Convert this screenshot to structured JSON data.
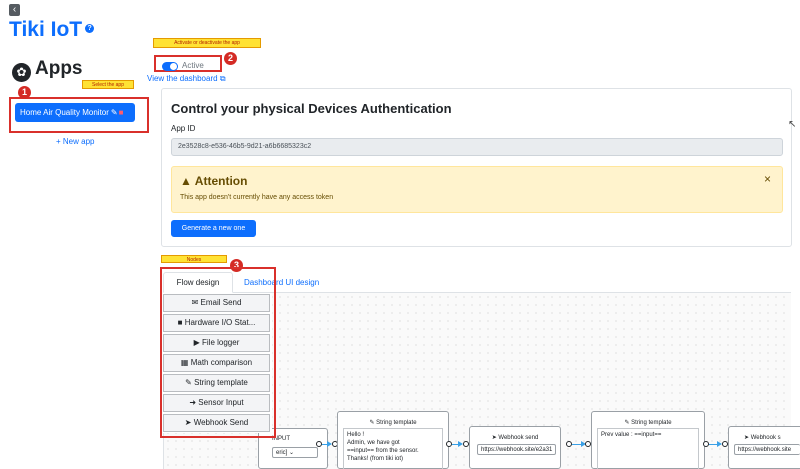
{
  "header": {
    "back_icon": "chevron-left-icon",
    "title": "Tiki IoT",
    "help_icon": "question-icon"
  },
  "sidebar": {
    "heading": "Apps",
    "heading_icon": "palette-icon",
    "app_label": "Home Air Quality Monitor",
    "app_edit_icon": "pencil-icon",
    "app_delete_icon": "trash-icon",
    "new_app_label": "+ New app"
  },
  "annotations": {
    "note_activate": "Activate or deactivate the app",
    "note_select": "Select the app",
    "note_nodes": "Nodes",
    "badge_1": "1",
    "badge_2": "2",
    "badge_3": "3"
  },
  "status": {
    "toggle_label": "Active",
    "toggle_on": true,
    "dashboard_link": "View the dashboard",
    "external_icon": "external-link-icon"
  },
  "auth_card": {
    "title": "Control your physical Devices Authentication",
    "app_id_label": "App ID",
    "app_id_value": "2e3528c8-e536-46b5-9d21-a6b6685323c2",
    "alert_title": "Attention",
    "alert_icon": "warning-icon",
    "alert_text": "This app doesn't currently have any access token",
    "alert_close": "×",
    "generate_button": "Generate a new one"
  },
  "tabs": {
    "flow_design": "Flow design",
    "dashboard_ui": "Dashboard UI design"
  },
  "node_palette": [
    {
      "icon": "envelope-icon",
      "glyph": "✉",
      "label": "Email Send"
    },
    {
      "icon": "chip-icon",
      "glyph": "■",
      "label": "Hardware I/O Stat..."
    },
    {
      "icon": "file-icon",
      "glyph": "▶",
      "label": "File logger"
    },
    {
      "icon": "calculator-icon",
      "glyph": "▦",
      "label": "Math comparison"
    },
    {
      "icon": "pen-icon",
      "glyph": "✎",
      "label": "String template"
    },
    {
      "icon": "sign-in-icon",
      "glyph": "➜",
      "label": "Sensor Input"
    },
    {
      "icon": "send-icon",
      "glyph": "➤",
      "label": "Webhook Send"
    }
  ],
  "flow": {
    "input_node_title": "INPUT",
    "input_node_select": "eric] ⌄",
    "string_template_1_title": "String template",
    "string_template_1_text": [
      "Hello !",
      "Admin, we have got",
      "==input== from the sensor.",
      "Thanks! (from tiki iot)"
    ],
    "webhook_1_title": "Webhook send",
    "webhook_1_url": "https://webhook.site/e2a31",
    "string_template_2_title": "String template",
    "string_template_2_text": "Prev value : ==input==",
    "webhook_2_title": "Webhook s",
    "webhook_2_url": "https://webhook.site"
  },
  "colors": {
    "primary": "#0d6efd",
    "callout_red": "#d9302b",
    "note_yellow": "#ffe234",
    "alert_bg": "#fff3cd",
    "edge_blue": "#3aa0e6"
  }
}
